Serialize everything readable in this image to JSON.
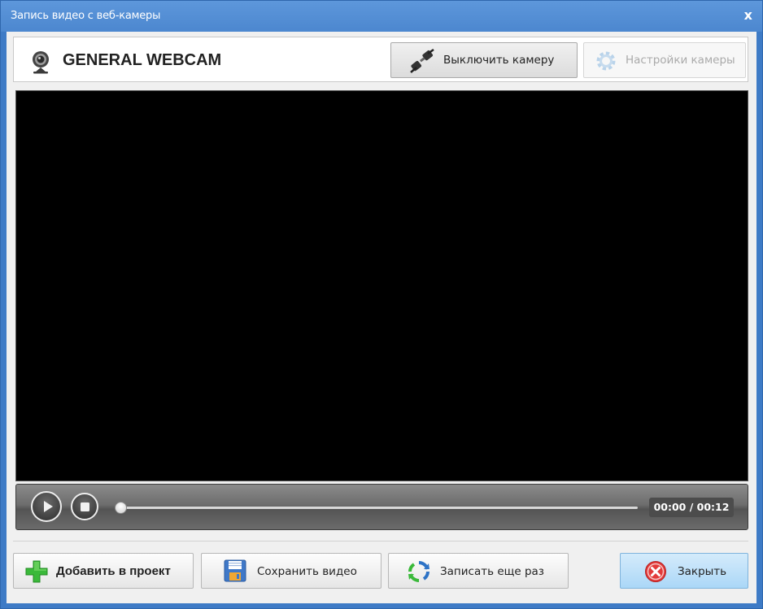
{
  "window": {
    "title": "Запись видео с веб-камеры",
    "close_glyph": "x"
  },
  "header": {
    "device_name": "GENERAL WEBCAM",
    "camera_off_label": "Выключить камеру",
    "camera_settings_label": "Настройки камеры"
  },
  "player": {
    "time_display": "00:00 / 00:12",
    "position_fraction": 0.0
  },
  "footer": {
    "add_label": "Добавить в проект",
    "save_label": "Сохранить видео",
    "record_label": "Записать еще раз",
    "close_label": "Закрыть"
  },
  "icons": {
    "webcam": "webcam-icon",
    "camera_off": "cable-icon",
    "camera_settings": "gear-icon",
    "add": "plus-icon",
    "save": "floppy-disk-icon",
    "record": "refresh-icon",
    "close": "close-circle-icon"
  },
  "colors": {
    "title_bar": "#4c87cf",
    "close_accent": "#e23a3a",
    "add_accent": "#3ab93a"
  }
}
